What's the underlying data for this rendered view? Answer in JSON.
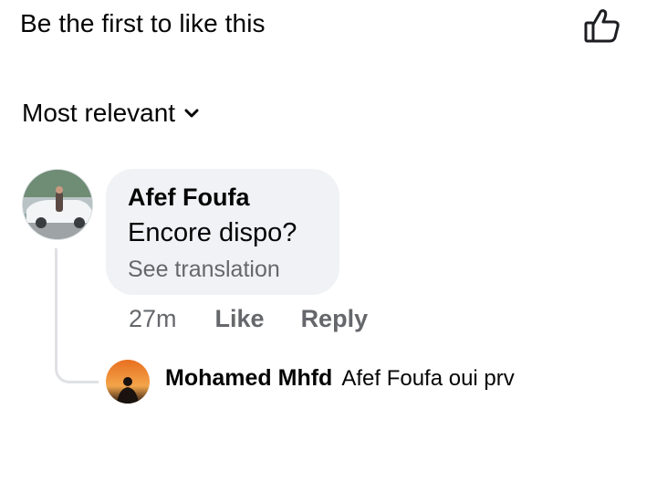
{
  "reactions": {
    "summary": "Be the first to like this"
  },
  "sort": {
    "label": "Most relevant"
  },
  "comment": {
    "author": "Afef Foufa",
    "text": "Encore dispo?",
    "see_translation": "See translation",
    "time": "27m",
    "like_label": "Like",
    "reply_label": "Reply"
  },
  "reply": {
    "author": "Mohamed Mhfd",
    "text": "Afef Foufa oui prv"
  },
  "icons": [
    "thumbs-up-icon",
    "chevron-down-icon"
  ],
  "colors": {
    "bubble": "#f0f2f5",
    "secondary_text": "#65676b",
    "primary_text": "#050505"
  }
}
